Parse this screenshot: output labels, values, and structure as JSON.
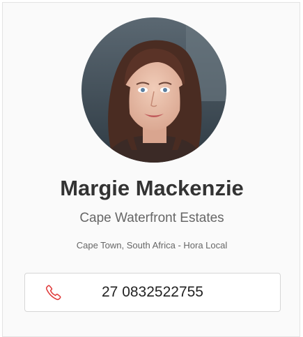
{
  "agent": {
    "avatar_alt": "Margie Mackenzie",
    "name": "Margie Mackenzie",
    "company": "Cape Waterfront Estates",
    "location": "Cape Town, South Africa - Hora Local",
    "phone": "27 0832522755",
    "phone_icon": "phone-icon"
  },
  "colors": {
    "accent": "#e03a3a",
    "card_background": "#fafafa",
    "card_border": "#e3e3e3",
    "text_dark": "#333333",
    "text_muted": "#666666"
  }
}
